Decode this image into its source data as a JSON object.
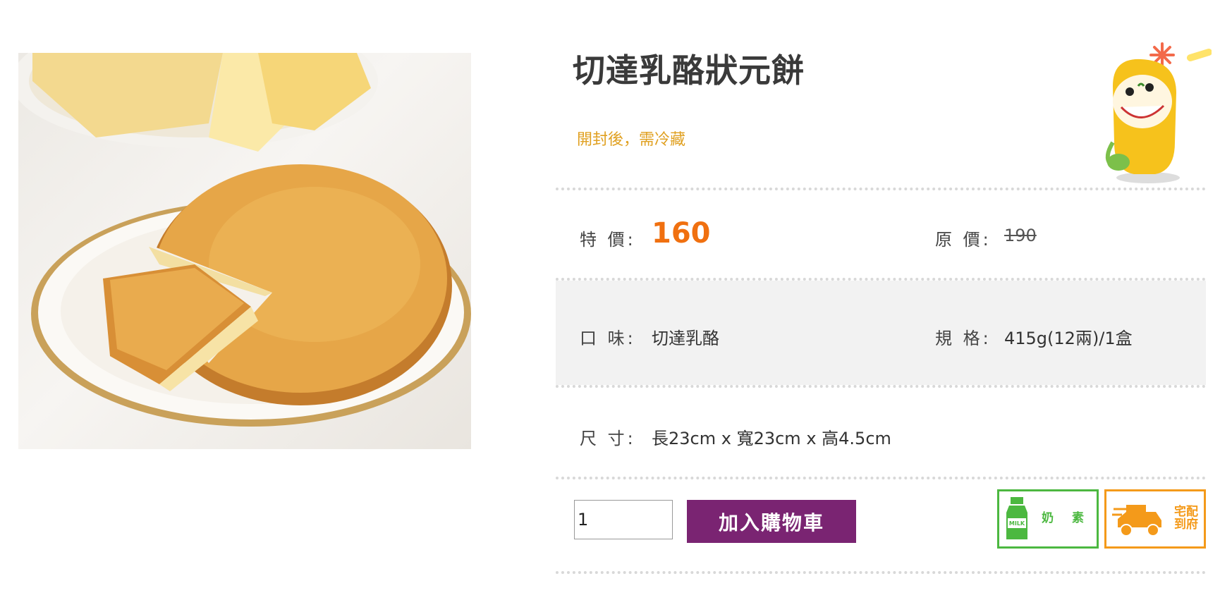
{
  "product": {
    "title": "切達乳酪狀元餅",
    "note": "開封後，需冷藏"
  },
  "price": {
    "special_label": "特 價:",
    "special_value": "160",
    "original_label": "原 價:",
    "original_value": "190"
  },
  "specs": {
    "flavor_label": "口 味:",
    "flavor_value": "切達乳酪",
    "spec_label": "規 格:",
    "spec_value": "415g(12兩)/1盒",
    "size_label": "尺 寸:",
    "size_value": "長23cm x 寬23cm x 高4.5cm"
  },
  "purchase": {
    "quantity": "1",
    "add_to_cart_label": "加入購物車"
  },
  "badges": {
    "milk_bottle_text": "MILK",
    "milk_label": "奶 素",
    "delivery_label_1": "宅配",
    "delivery_label_2": "到府"
  },
  "colors": {
    "price_accent": "#f07010",
    "note_color": "#e0a020",
    "cart_button": "#7a2472",
    "milk_green": "#4cb840",
    "delivery_orange": "#f49a1a"
  },
  "icons": {
    "mascot": "mascot-character-icon",
    "milk": "milk-bottle-icon",
    "delivery": "delivery-truck-icon"
  }
}
